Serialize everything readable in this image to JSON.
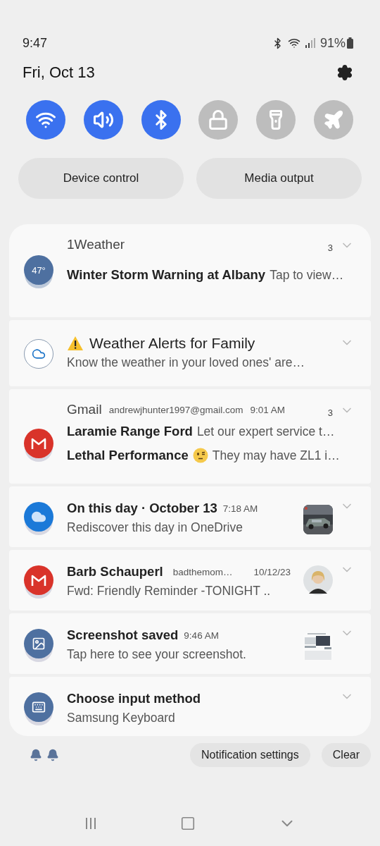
{
  "status_bar": {
    "time": "9:47",
    "battery": "91%"
  },
  "date": "Fri, Oct 13",
  "toggles": [
    {
      "kind": "wifi",
      "on": true
    },
    {
      "kind": "sound",
      "on": true
    },
    {
      "kind": "bluetooth",
      "on": true
    },
    {
      "kind": "lock",
      "on": false
    },
    {
      "kind": "flashlight",
      "on": false
    },
    {
      "kind": "airplane",
      "on": false
    }
  ],
  "panel_buttons": [
    "Device control",
    "Media output"
  ],
  "notifications": [
    {
      "kind": "grouped",
      "icon_text": "47°",
      "app": "1Weather",
      "count": "3",
      "lines": [
        {
          "title": "Winter Storm Warning at Albany",
          "text": "Tap to view…"
        }
      ]
    },
    {
      "kind": "alert",
      "title": "Weather Alerts for Family",
      "body": "Know the weather in your loved ones' are…"
    },
    {
      "kind": "grouped",
      "app": "Gmail",
      "account": "andrewjhunter1997@gmail.com",
      "time": "9:01 AM",
      "count": "3",
      "lines": [
        {
          "title": "Laramie Range Ford",
          "text": "Let our expert service t…"
        },
        {
          "title": "Lethal Performance",
          "text": "They may have ZL1 i…"
        }
      ]
    },
    {
      "kind": "alert",
      "title": "On this day · October 13",
      "time": "7:18 AM",
      "body": "Rediscover this day in OneDrive"
    },
    {
      "kind": "alert",
      "title": "Barb Schauperl",
      "account": "badthemom…",
      "time": "10/12/23",
      "body": "Fwd: Friendly Reminder -TONIGHT .."
    },
    {
      "kind": "alert",
      "title": "Screenshot saved",
      "time": "9:46 AM",
      "body": "Tap here to see your screenshot."
    },
    {
      "kind": "alert",
      "title": "Choose input method",
      "body": "Samsung Keyboard"
    }
  ],
  "footer": {
    "settings": "Notification settings",
    "clear": "Clear"
  }
}
